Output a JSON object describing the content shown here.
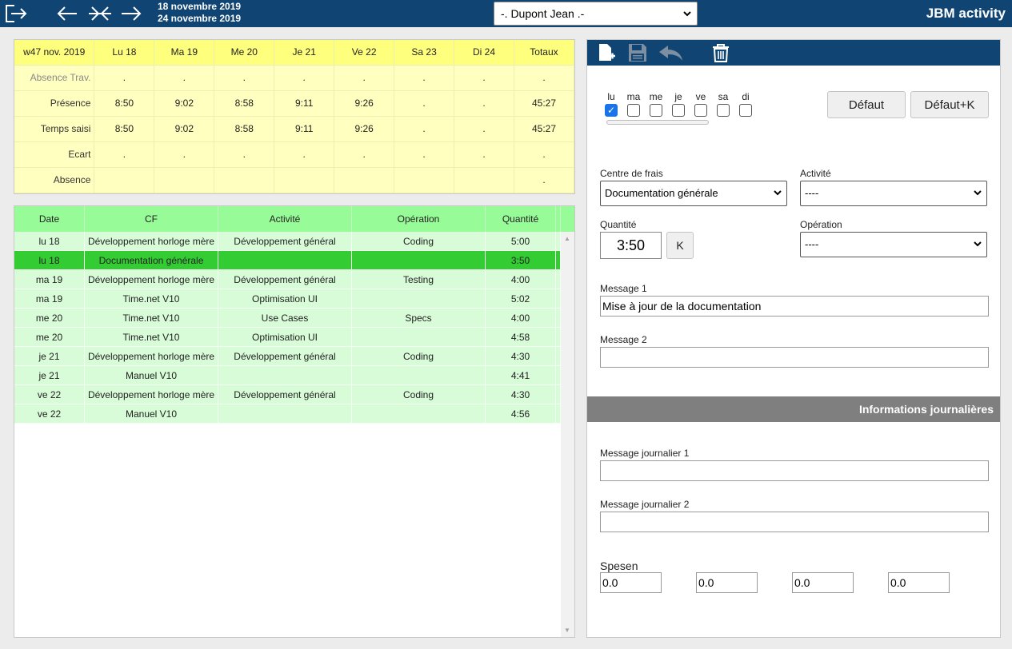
{
  "topbar": {
    "date_start": "18 novembre 2019",
    "date_end": "24 novembre 2019",
    "user_selected": "-. Dupont Jean .-",
    "app_name": "JBM activity"
  },
  "summary": {
    "headers": [
      "w47 nov. 2019",
      "Lu 18",
      "Ma 19",
      "Me 20",
      "Je 21",
      "Ve 22",
      "Sa 23",
      "Di 24",
      "Totaux"
    ],
    "rows": [
      {
        "label": "Absence Trav.",
        "values": [
          ".",
          ".",
          ".",
          ".",
          ".",
          ".",
          ".",
          "."
        ]
      },
      {
        "label": "Présence",
        "values": [
          "8:50",
          "9:02",
          "8:58",
          "9:11",
          "9:26",
          ".",
          ".",
          "45:27"
        ]
      },
      {
        "label": "Temps saisi",
        "values": [
          "8:50",
          "9:02",
          "8:58",
          "9:11",
          "9:26",
          ".",
          ".",
          "45:27"
        ]
      },
      {
        "label": "Ecart",
        "values": [
          ".",
          ".",
          ".",
          ".",
          ".",
          ".",
          ".",
          "."
        ]
      },
      {
        "label": "Absence",
        "values": [
          "",
          "",
          "",
          "",
          "",
          "",
          "",
          "."
        ]
      }
    ]
  },
  "entries": {
    "headers": [
      "Date",
      "CF",
      "Activité",
      "Opération",
      "Quantité"
    ],
    "rows": [
      [
        "lu 18",
        "Développement horloge mère",
        "Développement général",
        "Coding",
        "5:00"
      ],
      [
        "lu 18",
        "Documentation générale",
        "",
        "",
        "3:50"
      ],
      [
        "ma 19",
        "Développement horloge mère",
        "Développement général",
        "Testing",
        "4:00"
      ],
      [
        "ma 19",
        "Time.net V10",
        "Optimisation UI",
        "",
        "5:02"
      ],
      [
        "me 20",
        "Time.net V10",
        "Use Cases",
        "Specs",
        "4:00"
      ],
      [
        "me 20",
        "Time.net V10",
        "Optimisation UI",
        "",
        "4:58"
      ],
      [
        "je 21",
        "Développement horloge mère",
        "Développement général",
        "Coding",
        "4:30"
      ],
      [
        "je 21",
        "Manuel V10",
        "",
        "",
        "4:41"
      ],
      [
        "ve 22",
        "Développement horloge mère",
        "Développement général",
        "Coding",
        "4:30"
      ],
      [
        "ve 22",
        "Manuel V10",
        "",
        "",
        "4:56"
      ]
    ]
  },
  "form": {
    "days": [
      {
        "label": "lu",
        "checked": true
      },
      {
        "label": "ma",
        "checked": false
      },
      {
        "label": "me",
        "checked": false
      },
      {
        "label": "je",
        "checked": false
      },
      {
        "label": "ve",
        "checked": false
      },
      {
        "label": "sa",
        "checked": false
      },
      {
        "label": "di",
        "checked": false
      }
    ],
    "default_button": "Défaut",
    "default_k_button": "Défaut+K",
    "centre_label": "Centre de frais",
    "centre_value": "Documentation générale",
    "activite_label": "Activité",
    "activite_value": "----",
    "quantite_label": "Quantité",
    "quantite_value": "3:50",
    "k_button": "K",
    "operation_label": "Opération",
    "operation_value": "----",
    "message1_label": "Message 1",
    "message1_value": "Mise à jour de la documentation",
    "message2_label": "Message 2",
    "message2_value": "",
    "info_title": "Informations journalières",
    "daily1_label": "Message journalier 1",
    "daily1_value": "",
    "daily2_label": "Message journalier 2",
    "daily2_value": "",
    "spesen_label": "Spesen",
    "spesen_values": [
      "0.0",
      "0.0",
      "0.0",
      "0.0"
    ]
  },
  "icons": {
    "topbar": [
      "logout-icon",
      "previous-week-icon",
      "current-week-icon",
      "next-week-icon"
    ],
    "toolbar": [
      "new-entry-icon",
      "save-icon",
      "undo-icon",
      "delete-icon"
    ]
  },
  "colors": {
    "header_blue": "#0f4473",
    "summary_yellow": "#ffffc0",
    "entries_green": "#d7fcd7",
    "selected_green": "#33cc33"
  }
}
